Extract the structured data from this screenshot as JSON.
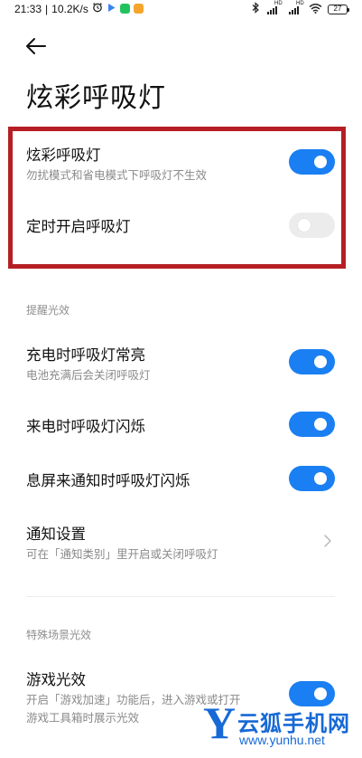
{
  "status_bar": {
    "time": "21:33",
    "speed": "10.2K/s",
    "signal1_tag": "HD",
    "signal2_tag": "HD",
    "battery": "27"
  },
  "header": {
    "title": "炫彩呼吸灯"
  },
  "main": {
    "toggles": [
      {
        "title": "炫彩呼吸灯",
        "subtitle": "勿扰模式和省电模式下呼吸灯不生效",
        "state": "on"
      },
      {
        "title": "定时开启呼吸灯",
        "state": "off"
      }
    ],
    "reminder_section": {
      "heading": "提醒光效",
      "items": [
        {
          "title": "充电时呼吸灯常亮",
          "subtitle": "电池充满后会关闭呼吸灯",
          "state": "on"
        },
        {
          "title": "来电时呼吸灯闪烁",
          "state": "on"
        },
        {
          "title": "息屏来通知时呼吸灯闪烁",
          "state": "on"
        }
      ],
      "notification_settings": {
        "title": "通知设置",
        "subtitle": "可在「通知类别」里开启或关闭呼吸灯"
      }
    },
    "special_section": {
      "heading": "特殊场景光效",
      "items": [
        {
          "title": "游戏光效",
          "subtitle_line1": "开启「游戏加速」功能后，进入游戏或打开",
          "subtitle_line2": "游戏工具箱时展示光效",
          "state": "on"
        }
      ]
    }
  },
  "watermark": {
    "logo_letter": "Y",
    "name": "云狐手机网",
    "url": "www.yunhu.net"
  },
  "colors": {
    "accent": "#1a7ff2",
    "highlight_border": "#b51f24",
    "watermark": "#1769d6"
  }
}
